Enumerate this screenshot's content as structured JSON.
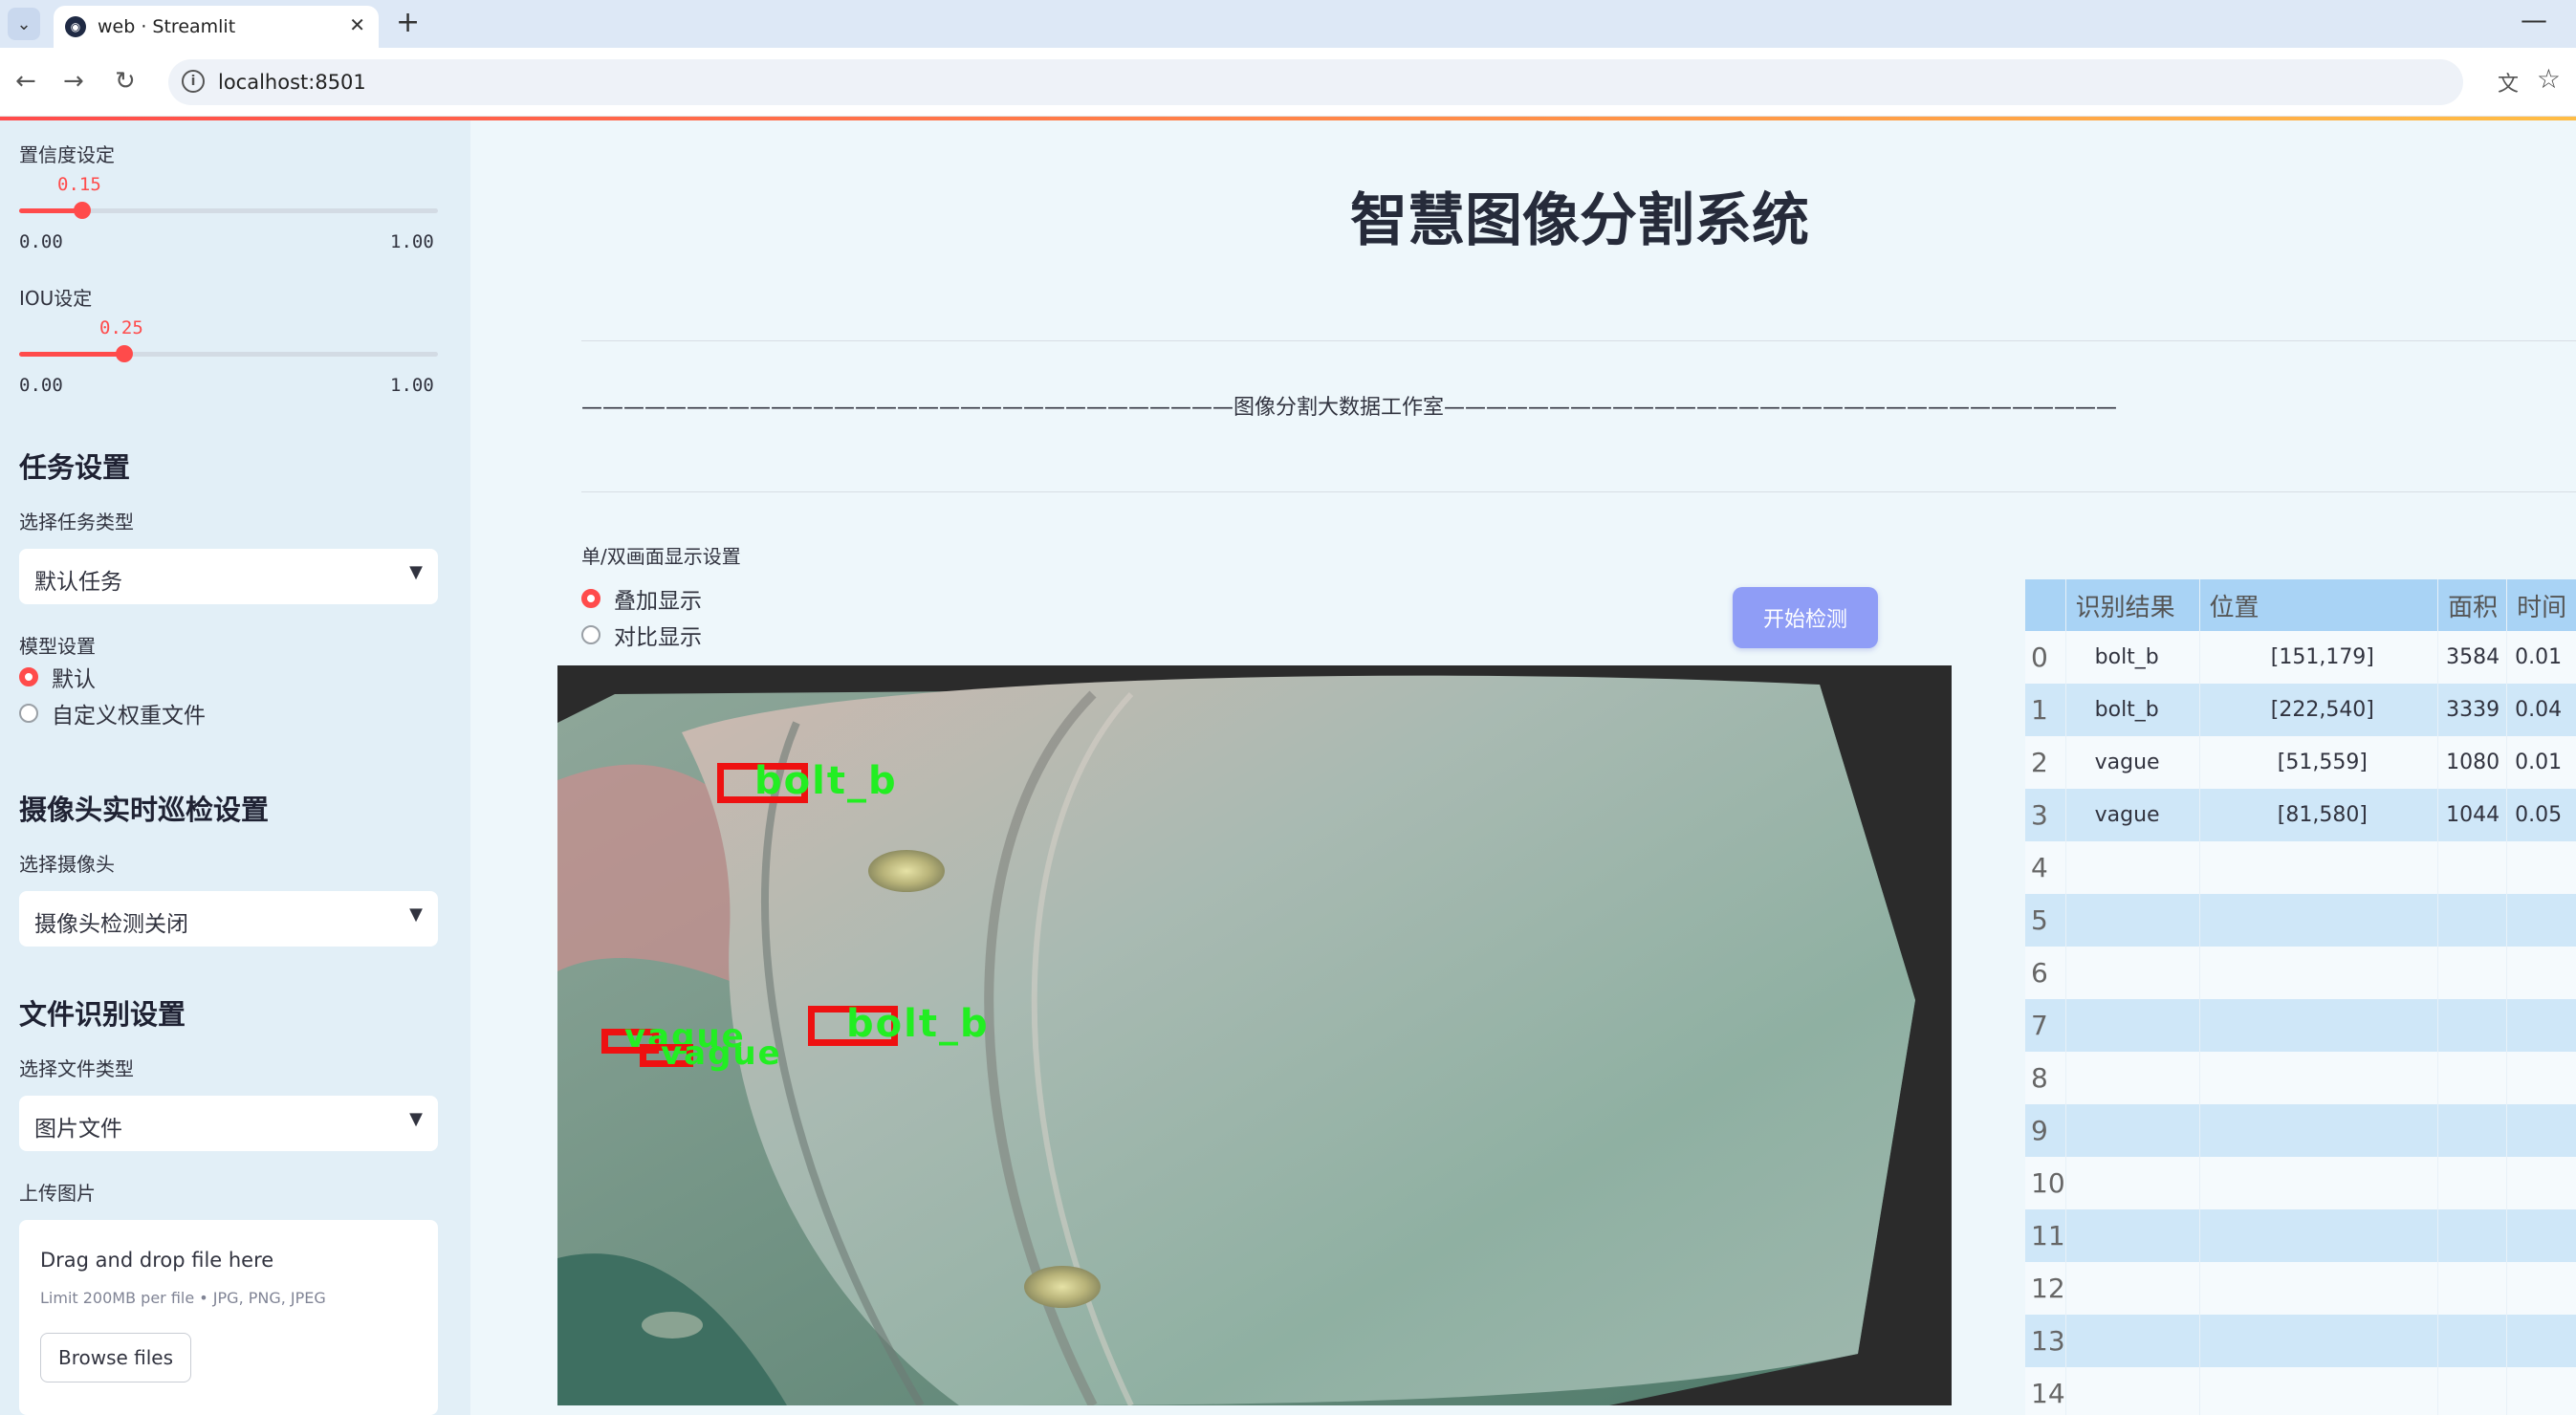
{
  "browser": {
    "tab_title": "web · Streamlit",
    "url": "localhost:8501"
  },
  "sidebar": {
    "confidence_label": "置信度设定",
    "confidence_value": "0.15",
    "confidence_fraction": 0.15,
    "iou_label": "IOU设定",
    "iou_value": "0.25",
    "iou_fraction": 0.25,
    "slider_min": "0.00",
    "slider_max": "1.00",
    "task_heading": "任务设置",
    "task_type_label": "选择任务类型",
    "task_type_value": "默认任务",
    "model_label": "模型设置",
    "model_options": [
      "默认",
      "自定义权重文件"
    ],
    "camera_heading": "摄像头实时巡检设置",
    "camera_label": "选择摄像头",
    "camera_value": "摄像头检测关闭",
    "file_heading": "文件识别设置",
    "file_type_label": "选择文件类型",
    "file_type_value": "图片文件",
    "upload_label": "上传图片",
    "upload_title": "Drag and drop file here",
    "upload_hint": "Limit 200MB per file • JPG, PNG, JPEG",
    "browse_label": "Browse files"
  },
  "main": {
    "title": "智慧图像分割系统",
    "divider_text": "———————————————————————————————图像分割大数据工作室————————————————————————————————",
    "display_label": "单/双画面显示设置",
    "display_options": [
      "叠加显示",
      "对比显示"
    ],
    "start_button": "开始检测",
    "detections": [
      "bolt_b",
      "bolt_b",
      "vague",
      "vague"
    ]
  },
  "table": {
    "columns": [
      "",
      "识别结果",
      "位置",
      "面积",
      "时间"
    ],
    "rows": [
      [
        "0",
        "bolt_b",
        "[151,179]",
        "3584",
        "0.01"
      ],
      [
        "1",
        "bolt_b",
        "[222,540]",
        "3339",
        "0.04"
      ],
      [
        "2",
        "vague",
        "[51,559]",
        "1080",
        "0.01"
      ],
      [
        "3",
        "vague",
        "[81,580]",
        "1044",
        "0.05"
      ],
      [
        "4",
        "",
        "",
        "",
        ""
      ],
      [
        "5",
        "",
        "",
        "",
        ""
      ],
      [
        "6",
        "",
        "",
        "",
        ""
      ],
      [
        "7",
        "",
        "",
        "",
        ""
      ],
      [
        "8",
        "",
        "",
        "",
        ""
      ],
      [
        "9",
        "",
        "",
        "",
        ""
      ],
      [
        "10",
        "",
        "",
        "",
        ""
      ],
      [
        "11",
        "",
        "",
        "",
        ""
      ],
      [
        "12",
        "",
        "",
        "",
        ""
      ],
      [
        "13",
        "",
        "",
        "",
        ""
      ],
      [
        "14",
        "",
        "",
        "",
        ""
      ]
    ]
  }
}
